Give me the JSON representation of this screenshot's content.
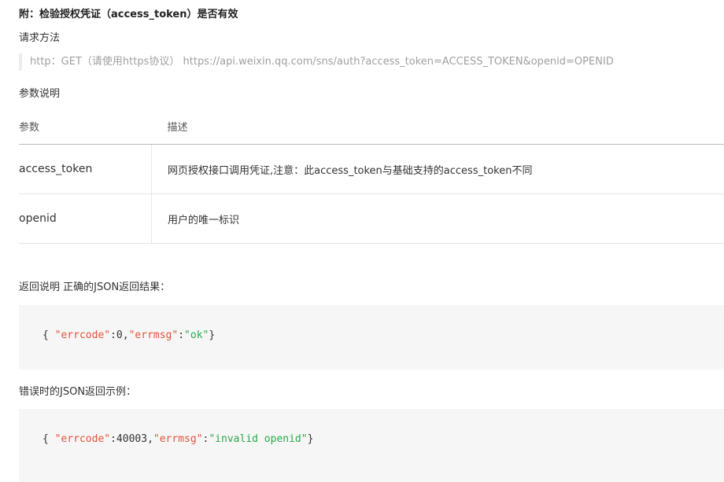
{
  "title": "附：检验授权凭证（access_token）是否有效",
  "request_method_label": "请求方法",
  "request_line": "http：GET（请使用https协议） https://api.weixin.qq.com/sns/auth?access_token=ACCESS_TOKEN&openid=OPENID",
  "params_label": "参数说明",
  "table": {
    "headers": [
      "参数",
      "描述"
    ],
    "rows": [
      {
        "name": "access_token",
        "desc": "网页授权接口调用凭证,注意：此access_token与基础支持的access_token不同"
      },
      {
        "name": "openid",
        "desc": "用户的唯一标识"
      }
    ]
  },
  "return_label": "返回说明 正确的JSON返回结果：",
  "success_code": {
    "open": "{ ",
    "key1": "\"errcode\"",
    "sep1": ":0,",
    "key2": "\"errmsg\"",
    "sep2": ":",
    "val2": "\"ok\"",
    "close": "}"
  },
  "error_label": "错误时的JSON返回示例：",
  "error_code": {
    "open": "{ ",
    "key1": "\"errcode\"",
    "sep1": ":40003,",
    "key2": "\"errmsg\"",
    "sep2": ":",
    "val2": "\"invalid openid\"",
    "close": "}"
  }
}
